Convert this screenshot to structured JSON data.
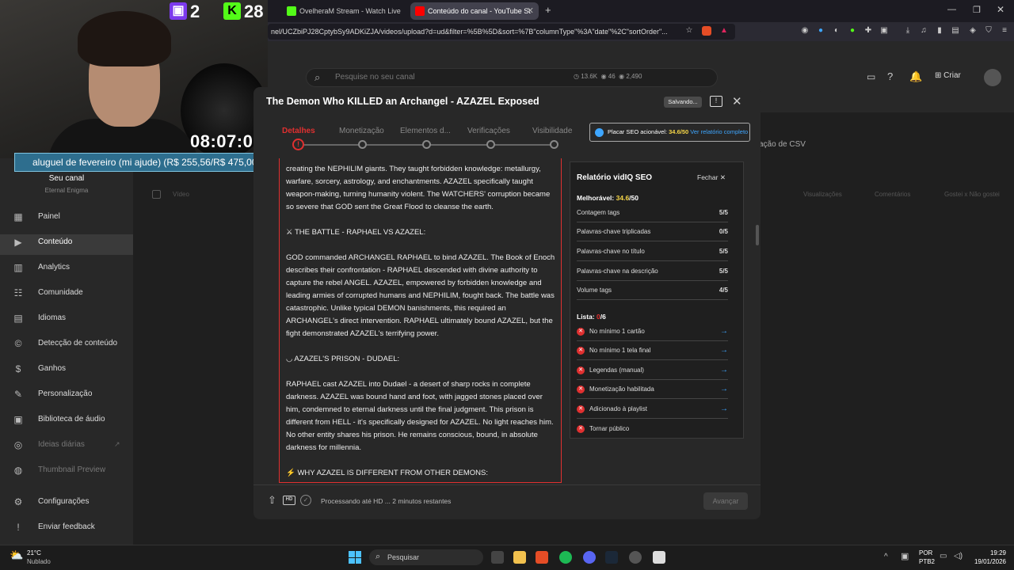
{
  "browser": {
    "tabs": [
      {
        "label": "OvelheraM Stream - Watch Live o"
      },
      {
        "label": "Conteúdo do canal - YouTube St"
      }
    ],
    "url": "nel/UCZbiPJ28CptybSy9ADKiZJA/videos/upload?d=ud&filter=%5B%5D&sort=%7B\"columnType\"%3A\"date\"%2C\"sortOrder\"..."
  },
  "stream_overlay": {
    "viewers_a": "2",
    "viewers_b": "28",
    "timer": "08:07:02",
    "goal": "aluguel de fevereiro (mi ajude) (R$ 255,56/R$ 475,00)"
  },
  "studio": {
    "search_placeholder": "Pesquise no seu canal",
    "stats": [
      "13.6K",
      "46",
      "2,490"
    ],
    "create_label": "Criar",
    "channel_label": "Seu canal",
    "channel_name": "Eternal Enigma",
    "csv_label": "ação de CSV",
    "columns": [
      "Vídeo",
      "Visualizações",
      "Comentários",
      "Gostei x Não gostei"
    ],
    "sidebar": [
      {
        "label": "Painel",
        "icon": "dashboard-icon"
      },
      {
        "label": "Conteúdo",
        "icon": "content-icon"
      },
      {
        "label": "Analytics",
        "icon": "analytics-icon"
      },
      {
        "label": "Comunidade",
        "icon": "community-icon"
      },
      {
        "label": "Idiomas",
        "icon": "languages-icon"
      },
      {
        "label": "Detecção de conteúdo",
        "icon": "copyright-icon"
      },
      {
        "label": "Ganhos",
        "icon": "earn-icon"
      },
      {
        "label": "Personalização",
        "icon": "customization-icon"
      },
      {
        "label": "Biblioteca de áudio",
        "icon": "audio-library-icon"
      },
      {
        "label": "Ideias diárias",
        "icon": "ideas-icon"
      },
      {
        "label": "Thumbnail Preview",
        "icon": "thumbnail-icon"
      },
      {
        "label": "Configurações",
        "icon": "settings-icon"
      },
      {
        "label": "Enviar feedback",
        "icon": "feedback-icon"
      }
    ]
  },
  "dialog": {
    "title": "The Demon Who KILLED an Archangel - AZAZEL Exposed",
    "saving": "Salvando...",
    "steps": [
      "Detalhes",
      "Monetização",
      "Elementos d...",
      "Verificações",
      "Visibilidade"
    ],
    "seo_badge_label": "Placar SEO acionável:",
    "seo_badge_score": "34.6/50",
    "seo_badge_link": "Ver relatório completo",
    "description": [
      "creating the NEPHILIM giants. They taught forbidden knowledge: metallurgy, warfare, sorcery, astrology, and enchantments. AZAZEL specifically taught weapon-making, turning humanity violent. The WATCHERS' corruption became so severe that GOD sent the Great Flood to cleanse the earth.",
      "⚔ THE BATTLE - RAPHAEL VS AZAZEL:",
      "GOD commanded ARCHANGEL RAPHAEL to bind AZAZEL. The Book of Enoch describes their confrontation - RAPHAEL descended with divine authority to capture the rebel ANGEL. AZAZEL, empowered by forbidden knowledge and leading armies of corrupted humans and NEPHILIM, fought back. The battle was catastrophic. Unlike typical DEMON banishments, this required an ARCHANGEL's direct intervention. RAPHAEL ultimately bound AZAZEL, but the fight demonstrated AZAZEL's terrifying power.",
      "◡ AZAZEL'S PRISON - DUDAEL:",
      "RAPHAEL cast AZAZEL into Dudael - a desert of sharp rocks in complete darkness. AZAZEL was bound hand and foot, with jagged stones placed over him, condemned to eternal darkness until the final judgment. This prison is different from HELL - it's specifically designed for AZAZEL. No light reaches him. No other entity shares his prison. He remains conscious, bound, in absolute darkness for millennia.",
      "⚡ WHY AZAZEL IS DIFFERENT FROM OTHER DEMONS:"
    ],
    "footer_status": "Processando até HD ... 2 minutos restantes",
    "next_label": "Avançar"
  },
  "seo_panel": {
    "title": "Relatório vidIQ SEO",
    "close_label": "Fechar",
    "score_label": "Melhorável:",
    "score_value": "34.6",
    "score_total": "/50",
    "rows": [
      {
        "label": "Contagem tags",
        "value": "5/5"
      },
      {
        "label": "Palavras-chave triplicadas",
        "value": "0/5"
      },
      {
        "label": "Palavras-chave no título",
        "value": "5/5"
      },
      {
        "label": "Palavras-chave na descrição",
        "value": "5/5"
      },
      {
        "label": "Volume tags",
        "value": "4/5"
      }
    ],
    "list_label": "Lista:",
    "list_done": "0",
    "list_total": "/6",
    "checklist": [
      {
        "label": "No mínimo 1 cartão"
      },
      {
        "label": "No mínimo 1 tela final"
      },
      {
        "label": "Legendas (manual)"
      },
      {
        "label": "Monetização habilitada"
      },
      {
        "label": "Adicionado à playlist"
      },
      {
        "label": "Tornar público"
      }
    ]
  },
  "taskbar": {
    "weather_temp": "21°C",
    "weather_desc": "Nublado",
    "search_placeholder": "Pesquisar",
    "lang": "POR",
    "layout": "PTB2",
    "time": "19:29",
    "date": "19/01/2026"
  }
}
